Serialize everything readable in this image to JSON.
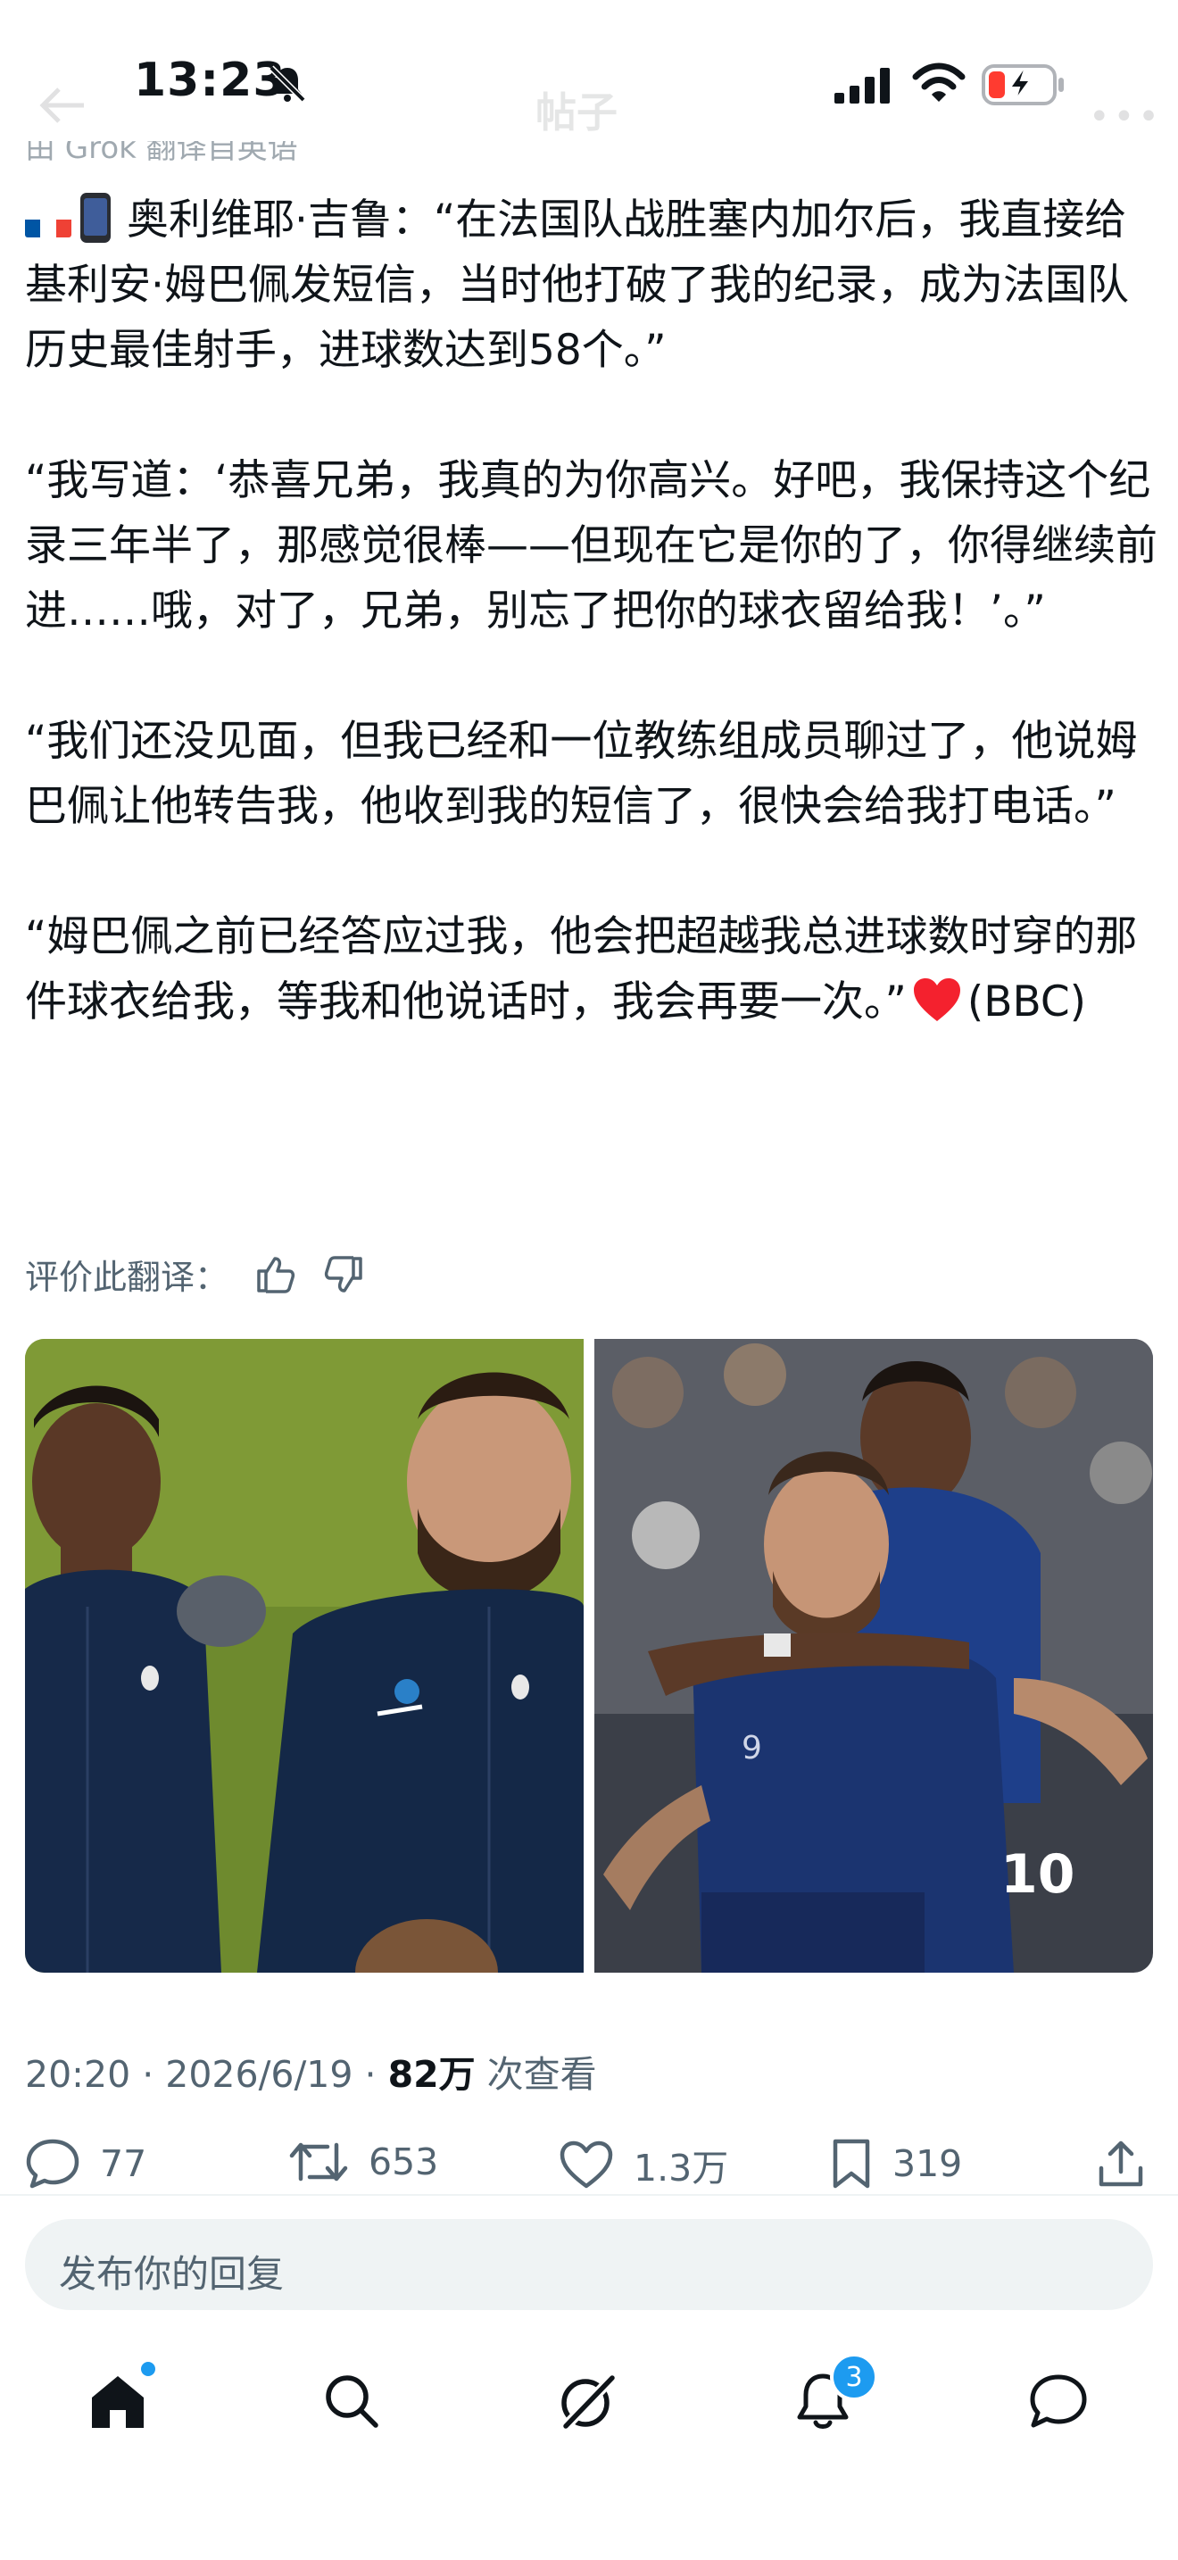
{
  "status_bar": {
    "time": "13:23"
  },
  "header": {
    "title": "帖子"
  },
  "post": {
    "paragraphs": [
      "奥利维耶·吉鲁：“在法国队战胜塞内加尔后，我直接给基利安·姆巴佩发短信，当时他打破了我的纪录，成为法国队历史最佳射手，进球数达到58个。”",
      "“我写道：‘恭喜兄弟，我真的为你高兴。好吧，我保持这个纪录三年半了，那感觉很棒——但现在它是你的了，你得继续前进……哦，对了，兄弟，别忘了把你的球衣留给我！’。”",
      "“我们还没见面，但我已经和一位教练组成员聊过了，他说姆巴佩让他转告我，他收到我的短信了，很快会给我打电话。”"
    ],
    "last_paragraph_text": "“姆巴佩之前已经答应过我，他会把超越我总进球数时穿的那件球衣给我，等我和他说话时，我会再要一次。”",
    "source_tag": "(BBC)",
    "rate_translation": "评价此翻译：",
    "timestamp": "20:20 · 2026/6/19 · ",
    "views_count": "82万",
    "views_label": " 次查看"
  },
  "actions": {
    "replies": "77",
    "reposts": "653",
    "likes": "1.3万",
    "bookmarks": "319"
  },
  "reply_box": {
    "placeholder": "发布你的回复"
  },
  "tab_bar": {
    "notifications_badge": "3"
  },
  "colors": {
    "accent": "#1d9bf0",
    "text": "#0f1419",
    "secondary": "#536471",
    "heart": "#f4212e"
  }
}
